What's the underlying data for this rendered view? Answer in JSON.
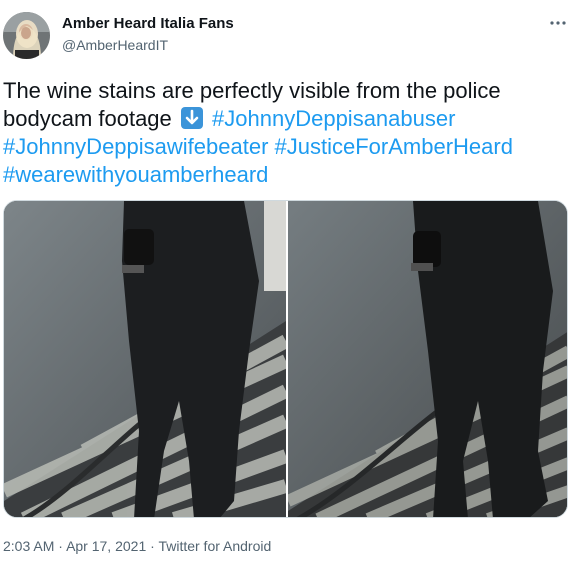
{
  "tweet": {
    "author_name": "Amber Heard Italia Fans",
    "author_handle": "@AmberHeardIT",
    "text_line1": "The wine stains are perfectly visible from the police",
    "text_line2_prefix": "bodycam footage",
    "hashtags": [
      "#JohnnyDeppisanabuser",
      "#JohnnyDeppisawifebeater",
      "#JusticeForAmberHeard",
      "#wearewithyouamberheard"
    ],
    "emoji": "down-arrow-emoji",
    "images": [
      {
        "alt": "bodycam-footage-frame-1"
      },
      {
        "alt": "bodycam-footage-frame-2"
      }
    ],
    "time": "2:03 AM",
    "separator": "·",
    "date": "Apr 17, 2021",
    "source": "Twitter for Android"
  },
  "colors": {
    "link": "#1d9bf0",
    "text": "#0f1419",
    "secondary": "#536471",
    "emoji_bg": "#3b94d9"
  },
  "icons": {
    "more": "more-options-icon",
    "avatar": "profile-avatar"
  }
}
